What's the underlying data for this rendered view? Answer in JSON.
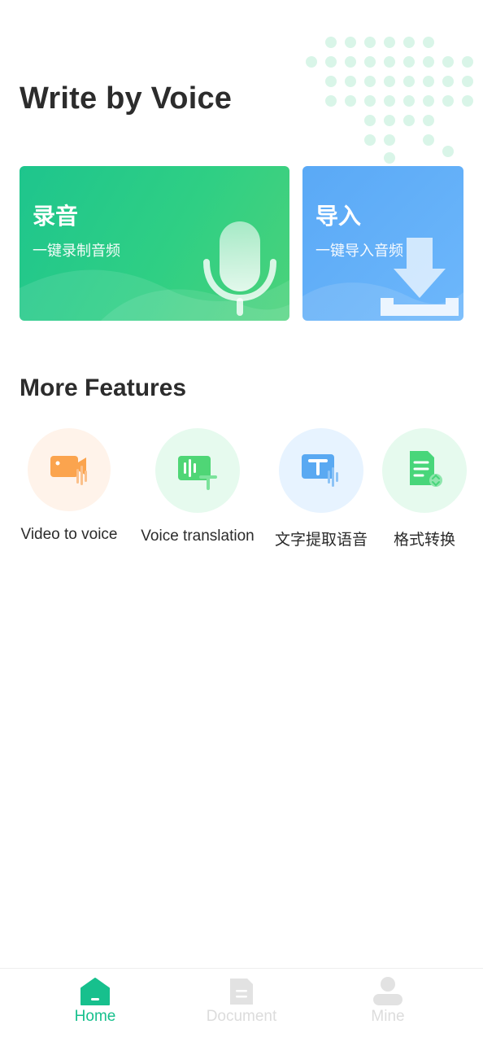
{
  "header": {
    "title": "Write by Voice"
  },
  "cards": {
    "record": {
      "title": "录音",
      "subtitle": "一键录制音频"
    },
    "import": {
      "title": "导入",
      "subtitle": "一键导入音频"
    }
  },
  "features": {
    "title": "More Features",
    "items": [
      {
        "label": "Video to voice",
        "icon": "video-voice-icon",
        "bg": "#fff3ea",
        "color": "#fba44e"
      },
      {
        "label": "Voice translation",
        "icon": "voice-translation-icon",
        "bg": "#e6faee",
        "color": "#4fd676"
      },
      {
        "label": "文字提取语音",
        "icon": "text-to-speech-icon",
        "bg": "#e7f3ff",
        "color": "#5aa9f2"
      },
      {
        "label": "格式转换",
        "icon": "format-convert-icon",
        "bg": "#e6faee",
        "color": "#48d67a"
      }
    ]
  },
  "tabbar": {
    "items": [
      {
        "label": "Home",
        "icon": "home-icon",
        "active": true
      },
      {
        "label": "Document",
        "icon": "document-icon",
        "active": false
      },
      {
        "label": "Mine",
        "icon": "user-icon",
        "active": false
      }
    ]
  },
  "colors": {
    "accent": "#17c08d",
    "record_card": "#2dce86",
    "import_card": "#62afF8"
  }
}
